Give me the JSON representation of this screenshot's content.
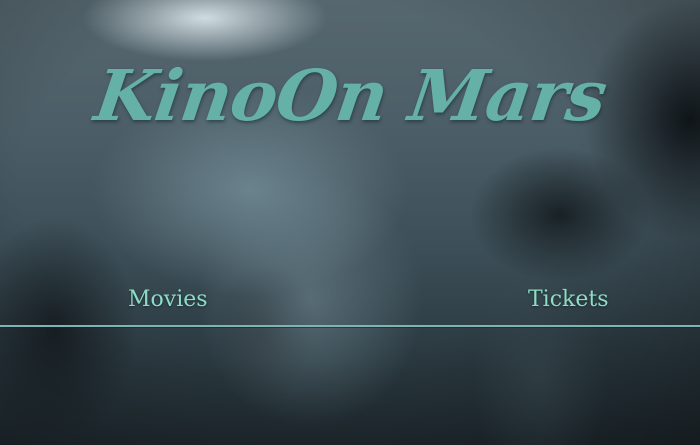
{
  "header": {
    "logo_text": "KinoOn Mars"
  },
  "nav": {
    "items": [
      {
        "label": "Movies"
      },
      {
        "label": "Tickets"
      }
    ]
  },
  "colors": {
    "logo": "#65b1a7",
    "nav_link": "#8ddcc6",
    "divider": "#80b4b4",
    "background": "#2b3940"
  }
}
